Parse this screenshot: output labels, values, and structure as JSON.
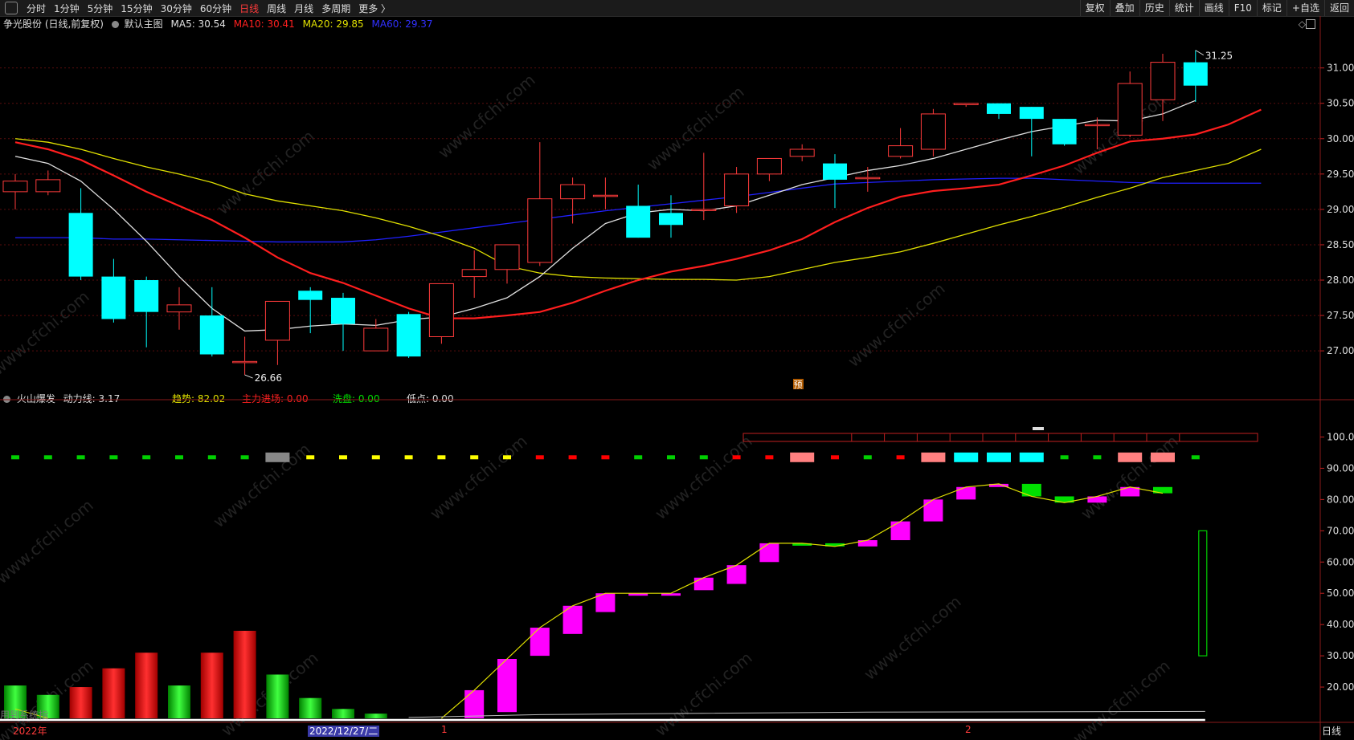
{
  "toolbar": {
    "periods": [
      "分时",
      "1分钟",
      "5分钟",
      "15分钟",
      "30分钟",
      "60分钟",
      "日线",
      "周线",
      "月线",
      "多周期",
      "更多 〉"
    ],
    "active_period": "日线",
    "right_buttons": [
      "复权",
      "叠加",
      "历史",
      "统计",
      "画线",
      "F10",
      "标记",
      "+自选",
      "返回"
    ]
  },
  "main_info": {
    "stock": "争光股份 (日线,前复权)",
    "template": "默认主图",
    "ma5": "MA5: 30.54",
    "ma10": "MA10: 30.41",
    "ma20": "MA20: 29.85",
    "ma60": "MA60: 29.37"
  },
  "sub_info": {
    "name": "火山爆发",
    "power": "动力线: 3.17",
    "trend": "趋势: 82.02",
    "main_force": "主力进场: 0.00",
    "wash": "洗盘: 0.00",
    "low": "低点: 0.00"
  },
  "annotations": {
    "high_label": "31.25",
    "low_label": "26.66",
    "forecast_badge": "预"
  },
  "price_axis": [
    "31.00",
    "30.50",
    "30.00",
    "29.50",
    "29.00",
    "28.50",
    "28.00",
    "27.50",
    "27.00"
  ],
  "sub_axis": [
    "100.0",
    "90.00",
    "80.00",
    "70.00",
    "60.00",
    "50.00",
    "40.00",
    "30.00",
    "20.00"
  ],
  "bottom": {
    "year": "2022年",
    "selected_date": "2022/12/27/二",
    "month1": "1",
    "month2": "2",
    "period_label": "日线",
    "watermark_text": "www.cfchi.com",
    "overlay_text": "用到系统指"
  },
  "colors": {
    "up": "#ff3b3b",
    "down": "#00ffff",
    "ma5": "#e0e0e0",
    "ma10": "#ff1e1e",
    "ma20": "#e0e000",
    "ma60": "#2020ff",
    "magenta": "#ff00ff",
    "green": "#00e000"
  },
  "chart_data": {
    "type": "candlestick",
    "price_range": [
      26.4,
      31.45
    ],
    "candles": [
      {
        "o": 29.25,
        "c": 29.4,
        "h": 29.5,
        "l": 29.0
      },
      {
        "o": 29.25,
        "c": 29.42,
        "h": 29.55,
        "l": 29.2
      },
      {
        "o": 28.95,
        "c": 28.05,
        "h": 29.3,
        "l": 28.0
      },
      {
        "o": 28.05,
        "c": 27.45,
        "h": 28.3,
        "l": 27.4
      },
      {
        "o": 28.0,
        "c": 27.55,
        "h": 28.05,
        "l": 27.05
      },
      {
        "o": 27.55,
        "c": 27.65,
        "h": 27.9,
        "l": 27.3
      },
      {
        "o": 27.5,
        "c": 26.95,
        "h": 27.9,
        "l": 26.92
      },
      {
        "o": 26.85,
        "c": 26.85,
        "h": 27.2,
        "l": 26.66
      },
      {
        "o": 27.15,
        "c": 27.7,
        "h": 27.7,
        "l": 26.8
      },
      {
        "o": 27.85,
        "c": 27.72,
        "h": 27.9,
        "l": 27.25
      },
      {
        "o": 27.75,
        "c": 27.38,
        "h": 27.82,
        "l": 27.0
      },
      {
        "o": 27.0,
        "c": 27.32,
        "h": 27.45,
        "l": 27.0
      },
      {
        "o": 27.52,
        "c": 26.92,
        "h": 27.55,
        "l": 26.9
      },
      {
        "o": 27.2,
        "c": 27.95,
        "h": 27.95,
        "l": 27.1
      },
      {
        "o": 28.05,
        "c": 28.15,
        "h": 28.42,
        "l": 27.75
      },
      {
        "o": 28.15,
        "c": 28.5,
        "h": 28.5,
        "l": 27.95
      },
      {
        "o": 28.25,
        "c": 29.15,
        "h": 29.95,
        "l": 28.2
      },
      {
        "o": 29.15,
        "c": 29.35,
        "h": 29.45,
        "l": 28.8
      },
      {
        "o": 29.2,
        "c": 29.2,
        "h": 29.45,
        "l": 29.0
      },
      {
        "o": 29.05,
        "c": 28.6,
        "h": 29.35,
        "l": 28.6
      },
      {
        "o": 28.95,
        "c": 28.78,
        "h": 29.2,
        "l": 28.6
      },
      {
        "o": 29.0,
        "c": 29.0,
        "h": 29.8,
        "l": 28.85
      },
      {
        "o": 29.05,
        "c": 29.5,
        "h": 29.6,
        "l": 28.95
      },
      {
        "o": 29.5,
        "c": 29.72,
        "h": 29.72,
        "l": 29.4
      },
      {
        "o": 29.75,
        "c": 29.85,
        "h": 29.92,
        "l": 29.68
      },
      {
        "o": 29.65,
        "c": 29.42,
        "h": 29.78,
        "l": 29.02
      },
      {
        "o": 29.45,
        "c": 29.45,
        "h": 29.6,
        "l": 29.25
      },
      {
        "o": 29.75,
        "c": 29.9,
        "h": 30.15,
        "l": 29.72
      },
      {
        "o": 29.85,
        "c": 30.35,
        "h": 30.42,
        "l": 29.75
      },
      {
        "o": 30.48,
        "c": 30.5,
        "h": 30.5,
        "l": 30.45
      },
      {
        "o": 30.5,
        "c": 30.35,
        "h": 30.5,
        "l": 30.28
      },
      {
        "o": 30.45,
        "c": 30.28,
        "h": 30.45,
        "l": 29.75
      },
      {
        "o": 30.28,
        "c": 29.92,
        "h": 30.28,
        "l": 29.9
      },
      {
        "o": 30.2,
        "c": 30.2,
        "h": 30.3,
        "l": 29.85
      },
      {
        "o": 30.05,
        "c": 30.78,
        "h": 30.95,
        "l": 30.02
      },
      {
        "o": 30.55,
        "c": 31.08,
        "h": 31.2,
        "l": 30.25
      },
      {
        "o": 31.08,
        "c": 30.75,
        "h": 31.25,
        "l": 30.52
      }
    ],
    "ma5": [
      29.75,
      29.65,
      29.4,
      29.0,
      28.55,
      28.05,
      27.6,
      27.28,
      27.3,
      27.35,
      27.38,
      27.36,
      27.44,
      27.48,
      27.6,
      27.75,
      28.05,
      28.45,
      28.8,
      28.95,
      29.0,
      28.98,
      29.05,
      29.2,
      29.35,
      29.45,
      29.55,
      29.62,
      29.72,
      29.85,
      29.98,
      30.1,
      30.18,
      30.26,
      30.25,
      30.35,
      30.54
    ],
    "ma10": [
      29.95,
      29.85,
      29.7,
      29.48,
      29.25,
      29.05,
      28.85,
      28.6,
      28.32,
      28.1,
      27.96,
      27.78,
      27.6,
      27.46,
      27.46,
      27.5,
      27.55,
      27.68,
      27.85,
      28.0,
      28.12,
      28.2,
      28.3,
      28.42,
      28.58,
      28.82,
      29.02,
      29.18,
      29.26,
      29.3,
      29.35,
      29.48,
      29.62,
      29.8,
      29.96,
      30.0,
      30.06,
      30.2,
      30.41
    ],
    "ma20": [
      30.0,
      29.95,
      29.85,
      29.72,
      29.6,
      29.5,
      29.38,
      29.22,
      29.12,
      29.05,
      28.98,
      28.88,
      28.76,
      28.62,
      28.45,
      28.2,
      28.1,
      28.05,
      28.03,
      28.02,
      28.01,
      28.01,
      28.0,
      28.05,
      28.15,
      28.25,
      28.32,
      28.4,
      28.52,
      28.65,
      28.78,
      28.9,
      29.03,
      29.17,
      29.3,
      29.45,
      29.55,
      29.65,
      29.85
    ],
    "ma60": [
      28.6,
      28.6,
      28.6,
      28.58,
      28.58,
      28.57,
      28.56,
      28.55,
      28.54,
      28.54,
      28.54,
      28.57,
      28.62,
      28.68,
      28.74,
      28.8,
      28.86,
      28.92,
      28.98,
      29.03,
      29.08,
      29.13,
      29.18,
      29.24,
      29.3,
      29.36,
      29.38,
      29.4,
      29.42,
      29.43,
      29.44,
      29.44,
      29.42,
      29.4,
      29.38,
      29.37,
      29.37,
      29.37,
      29.37
    ],
    "trend": [
      {
        "o": null,
        "c": null,
        "col": "none"
      },
      {
        "o": null,
        "c": null,
        "col": "none"
      },
      {
        "o": null,
        "c": null,
        "col": "none"
      },
      {
        "o": null,
        "c": null,
        "col": "none"
      },
      {
        "o": null,
        "c": null,
        "col": "none"
      },
      {
        "o": null,
        "c": null,
        "col": "none"
      },
      {
        "o": null,
        "c": null,
        "col": "none"
      },
      {
        "o": null,
        "c": null,
        "col": "none"
      },
      {
        "o": null,
        "c": null,
        "col": "none"
      },
      {
        "o": null,
        "c": null,
        "col": "none"
      },
      {
        "o": null,
        "c": null,
        "col": "none"
      },
      {
        "o": null,
        "c": null,
        "col": "none"
      },
      {
        "o": null,
        "c": null,
        "col": "none"
      },
      {
        "o": null,
        "c": null,
        "col": "none"
      },
      {
        "o": 10,
        "c": 19,
        "col": "magenta"
      },
      {
        "o": 12,
        "c": 29,
        "col": "magenta"
      },
      {
        "o": 30,
        "c": 39,
        "col": "magenta"
      },
      {
        "o": 37,
        "c": 46,
        "col": "magenta"
      },
      {
        "o": 44,
        "c": 50,
        "col": "magenta"
      },
      {
        "o": 50,
        "c": 50,
        "col": "magenta"
      },
      {
        "o": 50,
        "c": 50,
        "col": "magenta"
      },
      {
        "o": 51,
        "c": 55,
        "col": "magenta"
      },
      {
        "o": 53,
        "c": 59,
        "col": "magenta"
      },
      {
        "o": 60,
        "c": 66,
        "col": "magenta"
      },
      {
        "o": 66,
        "c": 66,
        "col": "green"
      },
      {
        "o": 65,
        "c": 66,
        "col": "green"
      },
      {
        "o": 65,
        "c": 67,
        "col": "magenta"
      },
      {
        "o": 67,
        "c": 73,
        "col": "magenta"
      },
      {
        "o": 73,
        "c": 80,
        "col": "magenta"
      },
      {
        "o": 80,
        "c": 84,
        "col": "magenta"
      },
      {
        "o": 84,
        "c": 85,
        "col": "magenta"
      },
      {
        "o": 85,
        "c": 81,
        "col": "green"
      },
      {
        "o": 81,
        "c": 79,
        "col": "green"
      },
      {
        "o": 79,
        "c": 81,
        "col": "magenta"
      },
      {
        "o": 81,
        "c": 84,
        "col": "magenta"
      },
      {
        "o": 84,
        "c": 82,
        "col": "green"
      }
    ],
    "trend_line": [
      19,
      29,
      39,
      46,
      50,
      50,
      50,
      55,
      59,
      66,
      66,
      65,
      67,
      73,
      80,
      84,
      85,
      81,
      79,
      81,
      84,
      82
    ],
    "volume_bars": [
      {
        "v": 10.5,
        "col": "green"
      },
      {
        "v": 7.5,
        "col": "green"
      },
      {
        "v": 10,
        "col": "red"
      },
      {
        "v": 16,
        "col": "red"
      },
      {
        "v": 21,
        "col": "red"
      },
      {
        "v": 10.5,
        "col": "green"
      },
      {
        "v": 21,
        "col": "red"
      },
      {
        "v": 28,
        "col": "red"
      },
      {
        "v": 14,
        "col": "green"
      },
      {
        "v": 6.5,
        "col": "green"
      },
      {
        "v": 3,
        "col": "green"
      },
      {
        "v": 1.5,
        "col": "green"
      }
    ],
    "signal_row": [
      "green",
      "green",
      "green",
      "green",
      "green",
      "green",
      "green",
      "green",
      "gray",
      "yellow",
      "yellow",
      "yellow",
      "yellow",
      "yellow",
      "yellow",
      "yellow",
      "red",
      "red",
      "red",
      "green",
      "green",
      "green",
      "red",
      "red",
      "pink",
      "red",
      "green",
      "red",
      "pink",
      "cyan",
      "cyan",
      "cyan",
      "green",
      "green",
      "pink",
      "pink",
      "green"
    ],
    "power_bar": {
      "from": 30,
      "to": 70
    },
    "sub_range": [
      10,
      105
    ]
  }
}
